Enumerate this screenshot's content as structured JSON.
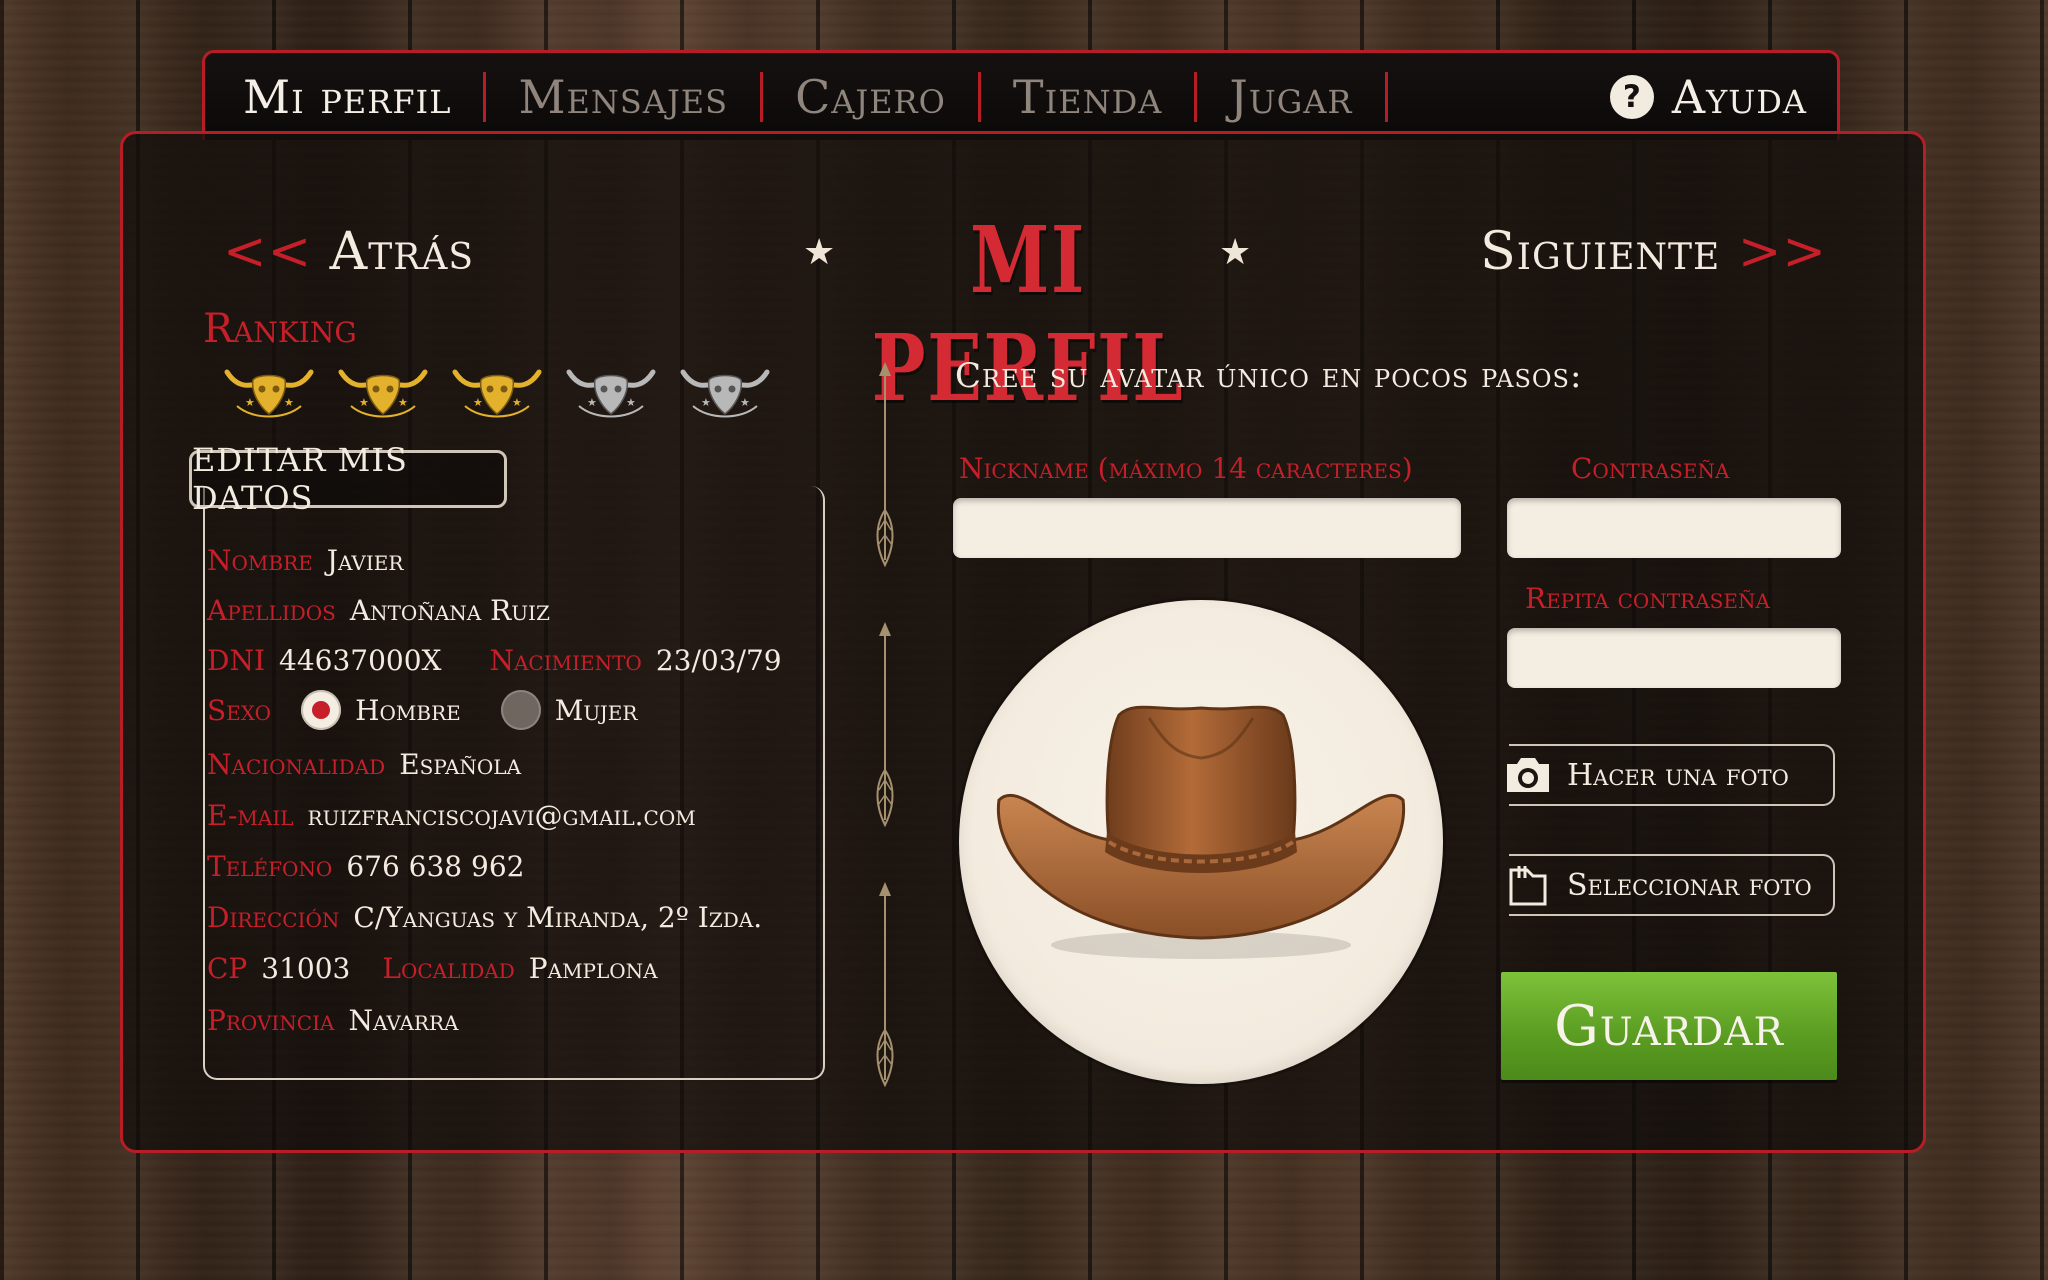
{
  "nav": {
    "items": [
      {
        "label": "Mi perfil",
        "active": true
      },
      {
        "label": "Mensajes",
        "active": false
      },
      {
        "label": "Cajero",
        "active": false
      },
      {
        "label": "Tienda",
        "active": false
      },
      {
        "label": "Jugar",
        "active": false
      }
    ],
    "help_icon": "?",
    "help_label": "Ayuda"
  },
  "header": {
    "back_arrow": "<<",
    "back_label": "Atrás",
    "title": "MI PERFIL",
    "next_label": "Siguiente",
    "next_arrow": ">>"
  },
  "ranking": {
    "label": "Ranking",
    "level": 3,
    "max": 5,
    "colors": {
      "active": "#e3b12c",
      "inactive": "#b8b8b8"
    }
  },
  "profile": {
    "edit_button": "EDITAR MIS DATOS",
    "nombre": {
      "label": "Nombre",
      "value": "Javier"
    },
    "apellidos": {
      "label": "Apellidos",
      "value": "Antoñana Ruiz"
    },
    "dni": {
      "label": "DNI",
      "value": "44637000X"
    },
    "nacimiento": {
      "label": "Nacimiento",
      "value": "23/03/79"
    },
    "sexo": {
      "label": "Sexo",
      "options": [
        "Hombre",
        "Mujer"
      ],
      "selected": "Hombre"
    },
    "nacionalidad": {
      "label": "Nacionalidad",
      "value": "Española"
    },
    "email": {
      "label": "E-mail",
      "value": "ruizfranciscojavi@gmail.com"
    },
    "telefono": {
      "label": "Teléfono",
      "value": "676 638 962"
    },
    "direccion": {
      "label": "Dirección",
      "value": "C/Yanguas y Miranda, 2º Izda."
    },
    "cp": {
      "label": "CP",
      "value": "31003"
    },
    "localidad": {
      "label": "Localidad",
      "value": "Pamplona"
    },
    "provincia": {
      "label": "Provincia",
      "value": "Navarra"
    }
  },
  "avatar_form": {
    "subtitle": "Cree su avatar único en pocos pasos:",
    "nickname_label": "Nickname (máximo 14 caracteres)",
    "nickname_value": "",
    "password_label": "Contraseña",
    "password_value": "",
    "repeat_password_label": "Repita contraseña",
    "repeat_password_value": "",
    "take_photo": "Hacer una foto",
    "select_photo": "Seleccionar foto",
    "save": "Guardar"
  },
  "colors": {
    "accent_red": "#c61f2a",
    "save_green": "#5c9f23",
    "panel_border": "#b61d27"
  }
}
